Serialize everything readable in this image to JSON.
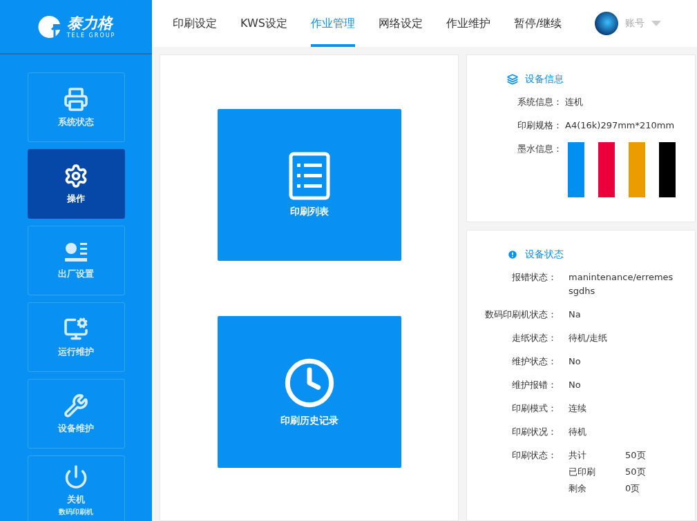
{
  "logo": {
    "name": "泰力格",
    "subtitle": "TELE GROUP"
  },
  "sidebar": {
    "items": [
      {
        "kind": "printer",
        "label": "系统状态",
        "selected": false
      },
      {
        "kind": "operate",
        "label": "操作",
        "selected": true
      },
      {
        "kind": "factory",
        "label": "出厂设置",
        "selected": false
      },
      {
        "kind": "monitor",
        "label": "运行维护",
        "selected": false
      },
      {
        "kind": "tools",
        "label": "设备维护",
        "selected": false
      },
      {
        "kind": "power",
        "label": "关机",
        "sublabel": "数码印刷机",
        "selected": false
      }
    ]
  },
  "tabs": [
    {
      "label": "印刷设定",
      "selected": false
    },
    {
      "label": "KWS设定",
      "selected": false
    },
    {
      "label": "作业管理",
      "selected": true
    },
    {
      "label": "网络设定",
      "selected": false
    },
    {
      "label": "作业维护",
      "selected": false
    },
    {
      "label": "暂停/继续",
      "selected": false
    }
  ],
  "account": {
    "label": "账号"
  },
  "tiles": [
    {
      "kind": "list",
      "label": "印刷列表"
    },
    {
      "kind": "history",
      "label": "印刷历史记录"
    }
  ],
  "device_info": {
    "title": "设备信息",
    "rows": [
      {
        "label": "系统信息：",
        "value": "连机"
      },
      {
        "label": "印刷规格：",
        "value": "A4(16k)297mm*210mm"
      }
    ],
    "ink": {
      "label": "墨水信息：",
      "inks": [
        {
          "color": "#0091f0"
        },
        {
          "color": "#ec003c"
        },
        {
          "color": "#ea9c00"
        },
        {
          "color": "#000000"
        }
      ]
    }
  },
  "device_status": {
    "title": "设备状态",
    "rows": [
      {
        "label": "报错状态：",
        "value": "manintenance/erremessgdhs"
      },
      {
        "label": "数码印刷机状态：",
        "value": "Na"
      },
      {
        "label": "走纸状态：",
        "value": "待机/走纸"
      },
      {
        "label": "维护状态：",
        "value": "No"
      },
      {
        "label": "维护报错：",
        "value": "No"
      },
      {
        "label": "印刷模式：",
        "value": "连续"
      },
      {
        "label": "印刷状况：",
        "value": "待机"
      }
    ],
    "print_status": {
      "label": "印刷状态：",
      "items": [
        {
          "name": "共计",
          "count": "50页"
        },
        {
          "name": "已印刷",
          "count": "50页"
        },
        {
          "name": "剩余",
          "count": "0页"
        }
      ]
    }
  }
}
